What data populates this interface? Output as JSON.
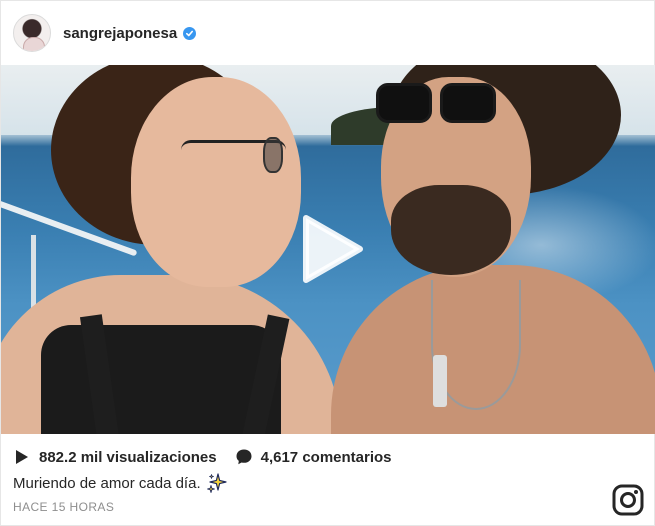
{
  "post": {
    "username": "sangrejaponesa",
    "verified": true,
    "views": "882.2 mil visualizaciones",
    "comments": "4,617 comentarios",
    "caption": "Muriendo de amor cada día.",
    "timestamp": "HACE 15 HORAS"
  },
  "icons": {
    "verified": "verified-badge-icon",
    "play": "play-icon",
    "views": "play-small-icon",
    "comments": "comment-bubble-icon",
    "sparkles": "sparkles-emoji",
    "brand": "instagram-logo-icon"
  },
  "colors": {
    "verified": "#3897f0",
    "text": "#262626",
    "muted": "#8e8e8e",
    "sparkle": "#f5d33a"
  }
}
